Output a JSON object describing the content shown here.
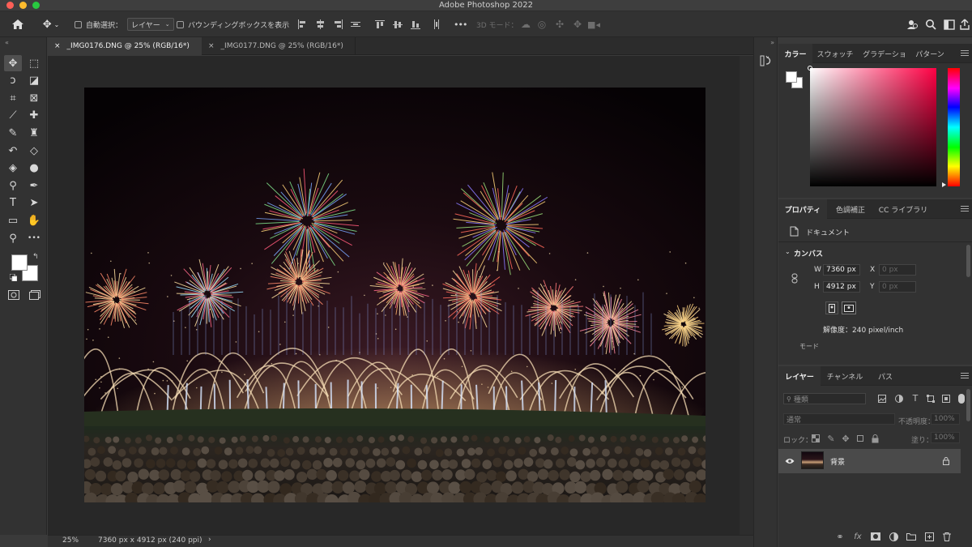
{
  "window": {
    "title": "Adobe Photoshop 2022",
    "traffic_colors": [
      "#fe5f57",
      "#febc2e",
      "#28c840"
    ]
  },
  "options_bar": {
    "auto_select_label": "自動選択：",
    "auto_select_value": "レイヤー",
    "bounding_box_label": "バウンディングボックスを表示",
    "more_label": "•••",
    "three_d_mode_label": "3D モード："
  },
  "tabs": [
    {
      "close": "×",
      "label": "_IMG0176.DNG @ 25% (RGB/16*)",
      "active": true
    },
    {
      "close": "×",
      "label": "_IMG0177.DNG @ 25% (RGB/16*)",
      "active": false
    }
  ],
  "toolbar": {
    "tools": [
      {
        "name": "move-tool-icon",
        "glyph": "✥"
      },
      {
        "name": "marquee-tool-icon",
        "glyph": "⬚"
      },
      {
        "name": "lasso-tool-icon",
        "glyph": "ↄ"
      },
      {
        "name": "object-select-tool-icon",
        "glyph": "◪"
      },
      {
        "name": "crop-tool-icon",
        "glyph": "⌗"
      },
      {
        "name": "frame-tool-icon",
        "glyph": "⊠"
      },
      {
        "name": "eyedropper-tool-icon",
        "glyph": "⟋"
      },
      {
        "name": "healing-brush-tool-icon",
        "glyph": "✚"
      },
      {
        "name": "brush-tool-icon",
        "glyph": "✎"
      },
      {
        "name": "stamp-tool-icon",
        "glyph": "♜"
      },
      {
        "name": "history-brush-tool-icon",
        "glyph": "↶"
      },
      {
        "name": "eraser-tool-icon",
        "glyph": "◇"
      },
      {
        "name": "paint-bucket-tool-icon",
        "glyph": "◈"
      },
      {
        "name": "blur-tool-icon",
        "glyph": "●"
      },
      {
        "name": "dodge-tool-icon",
        "glyph": "⚲"
      },
      {
        "name": "pen-tool-icon",
        "glyph": "✒"
      },
      {
        "name": "type-tool-icon",
        "glyph": "T"
      },
      {
        "name": "path-select-tool-icon",
        "glyph": "➤"
      },
      {
        "name": "rectangle-tool-icon",
        "glyph": "▭"
      },
      {
        "name": "hand-tool-icon",
        "glyph": "✋"
      },
      {
        "name": "zoom-tool-icon",
        "glyph": "⚲"
      },
      {
        "name": "more-tools-icon",
        "glyph": "•••"
      }
    ]
  },
  "status_bar": {
    "zoom": "25%",
    "doc_info": "7360 px x 4912 px (240 ppi)",
    "arrow": "›"
  },
  "color_panel": {
    "tabs": [
      "カラー",
      "スウォッチ",
      "グラデーショ",
      "パターン"
    ],
    "hue_color": "#ff0044"
  },
  "properties_panel": {
    "tabs": [
      "プロパティ",
      "色調補正",
      "CC ライブラリ"
    ],
    "document_label": "ドキュメント",
    "canvas_label": "カンバス",
    "w_label": "W",
    "w_value": "7360 px",
    "h_label": "H",
    "h_value": "4912 px",
    "x_label": "X",
    "x_placeholder": "0 px",
    "y_label": "Y",
    "y_placeholder": "0 px",
    "resolution": "解像度：240 pixel/inch",
    "mode_label": "モード"
  },
  "layers_panel": {
    "tabs": [
      "レイヤー",
      "チャンネル",
      "パス"
    ],
    "filter_placeholder": "種類",
    "blend_mode": "通常",
    "opacity_label": "不透明度：",
    "opacity_value": "100%",
    "lock_label": "ロック：",
    "fill_label": "塗り：",
    "fill_value": "100%",
    "layer_name": "背景"
  }
}
